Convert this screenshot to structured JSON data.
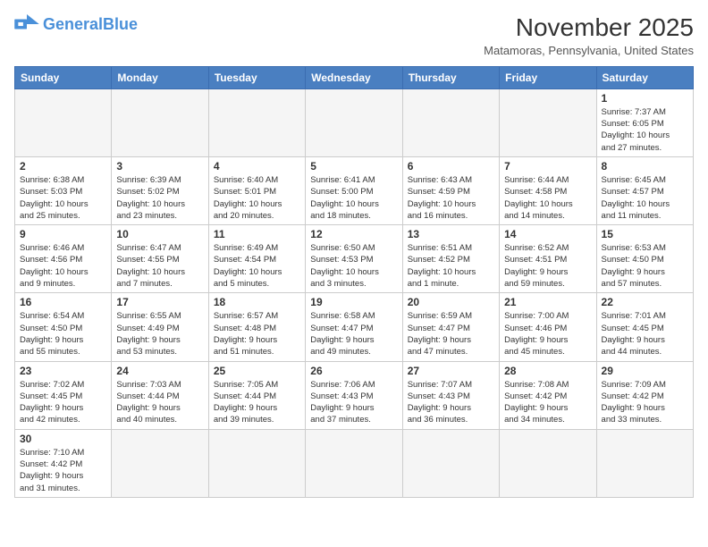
{
  "header": {
    "logo_general": "General",
    "logo_blue": "Blue",
    "month_year": "November 2025",
    "location": "Matamoras, Pennsylvania, United States"
  },
  "days_of_week": [
    "Sunday",
    "Monday",
    "Tuesday",
    "Wednesday",
    "Thursday",
    "Friday",
    "Saturday"
  ],
  "weeks": [
    [
      {
        "day": "",
        "info": ""
      },
      {
        "day": "",
        "info": ""
      },
      {
        "day": "",
        "info": ""
      },
      {
        "day": "",
        "info": ""
      },
      {
        "day": "",
        "info": ""
      },
      {
        "day": "",
        "info": ""
      },
      {
        "day": "1",
        "info": "Sunrise: 7:37 AM\nSunset: 6:05 PM\nDaylight: 10 hours\nand 27 minutes."
      }
    ],
    [
      {
        "day": "2",
        "info": "Sunrise: 6:38 AM\nSunset: 5:03 PM\nDaylight: 10 hours\nand 25 minutes."
      },
      {
        "day": "3",
        "info": "Sunrise: 6:39 AM\nSunset: 5:02 PM\nDaylight: 10 hours\nand 23 minutes."
      },
      {
        "day": "4",
        "info": "Sunrise: 6:40 AM\nSunset: 5:01 PM\nDaylight: 10 hours\nand 20 minutes."
      },
      {
        "day": "5",
        "info": "Sunrise: 6:41 AM\nSunset: 5:00 PM\nDaylight: 10 hours\nand 18 minutes."
      },
      {
        "day": "6",
        "info": "Sunrise: 6:43 AM\nSunset: 4:59 PM\nDaylight: 10 hours\nand 16 minutes."
      },
      {
        "day": "7",
        "info": "Sunrise: 6:44 AM\nSunset: 4:58 PM\nDaylight: 10 hours\nand 14 minutes."
      },
      {
        "day": "8",
        "info": "Sunrise: 6:45 AM\nSunset: 4:57 PM\nDaylight: 10 hours\nand 11 minutes."
      }
    ],
    [
      {
        "day": "9",
        "info": "Sunrise: 6:46 AM\nSunset: 4:56 PM\nDaylight: 10 hours\nand 9 minutes."
      },
      {
        "day": "10",
        "info": "Sunrise: 6:47 AM\nSunset: 4:55 PM\nDaylight: 10 hours\nand 7 minutes."
      },
      {
        "day": "11",
        "info": "Sunrise: 6:49 AM\nSunset: 4:54 PM\nDaylight: 10 hours\nand 5 minutes."
      },
      {
        "day": "12",
        "info": "Sunrise: 6:50 AM\nSunset: 4:53 PM\nDaylight: 10 hours\nand 3 minutes."
      },
      {
        "day": "13",
        "info": "Sunrise: 6:51 AM\nSunset: 4:52 PM\nDaylight: 10 hours\nand 1 minute."
      },
      {
        "day": "14",
        "info": "Sunrise: 6:52 AM\nSunset: 4:51 PM\nDaylight: 9 hours\nand 59 minutes."
      },
      {
        "day": "15",
        "info": "Sunrise: 6:53 AM\nSunset: 4:50 PM\nDaylight: 9 hours\nand 57 minutes."
      }
    ],
    [
      {
        "day": "16",
        "info": "Sunrise: 6:54 AM\nSunset: 4:50 PM\nDaylight: 9 hours\nand 55 minutes."
      },
      {
        "day": "17",
        "info": "Sunrise: 6:55 AM\nSunset: 4:49 PM\nDaylight: 9 hours\nand 53 minutes."
      },
      {
        "day": "18",
        "info": "Sunrise: 6:57 AM\nSunset: 4:48 PM\nDaylight: 9 hours\nand 51 minutes."
      },
      {
        "day": "19",
        "info": "Sunrise: 6:58 AM\nSunset: 4:47 PM\nDaylight: 9 hours\nand 49 minutes."
      },
      {
        "day": "20",
        "info": "Sunrise: 6:59 AM\nSunset: 4:47 PM\nDaylight: 9 hours\nand 47 minutes."
      },
      {
        "day": "21",
        "info": "Sunrise: 7:00 AM\nSunset: 4:46 PM\nDaylight: 9 hours\nand 45 minutes."
      },
      {
        "day": "22",
        "info": "Sunrise: 7:01 AM\nSunset: 4:45 PM\nDaylight: 9 hours\nand 44 minutes."
      }
    ],
    [
      {
        "day": "23",
        "info": "Sunrise: 7:02 AM\nSunset: 4:45 PM\nDaylight: 9 hours\nand 42 minutes."
      },
      {
        "day": "24",
        "info": "Sunrise: 7:03 AM\nSunset: 4:44 PM\nDaylight: 9 hours\nand 40 minutes."
      },
      {
        "day": "25",
        "info": "Sunrise: 7:05 AM\nSunset: 4:44 PM\nDaylight: 9 hours\nand 39 minutes."
      },
      {
        "day": "26",
        "info": "Sunrise: 7:06 AM\nSunset: 4:43 PM\nDaylight: 9 hours\nand 37 minutes."
      },
      {
        "day": "27",
        "info": "Sunrise: 7:07 AM\nSunset: 4:43 PM\nDaylight: 9 hours\nand 36 minutes."
      },
      {
        "day": "28",
        "info": "Sunrise: 7:08 AM\nSunset: 4:42 PM\nDaylight: 9 hours\nand 34 minutes."
      },
      {
        "day": "29",
        "info": "Sunrise: 7:09 AM\nSunset: 4:42 PM\nDaylight: 9 hours\nand 33 minutes."
      }
    ],
    [
      {
        "day": "30",
        "info": "Sunrise: 7:10 AM\nSunset: 4:42 PM\nDaylight: 9 hours\nand 31 minutes."
      },
      {
        "day": "",
        "info": ""
      },
      {
        "day": "",
        "info": ""
      },
      {
        "day": "",
        "info": ""
      },
      {
        "day": "",
        "info": ""
      },
      {
        "day": "",
        "info": ""
      },
      {
        "day": "",
        "info": ""
      }
    ]
  ]
}
